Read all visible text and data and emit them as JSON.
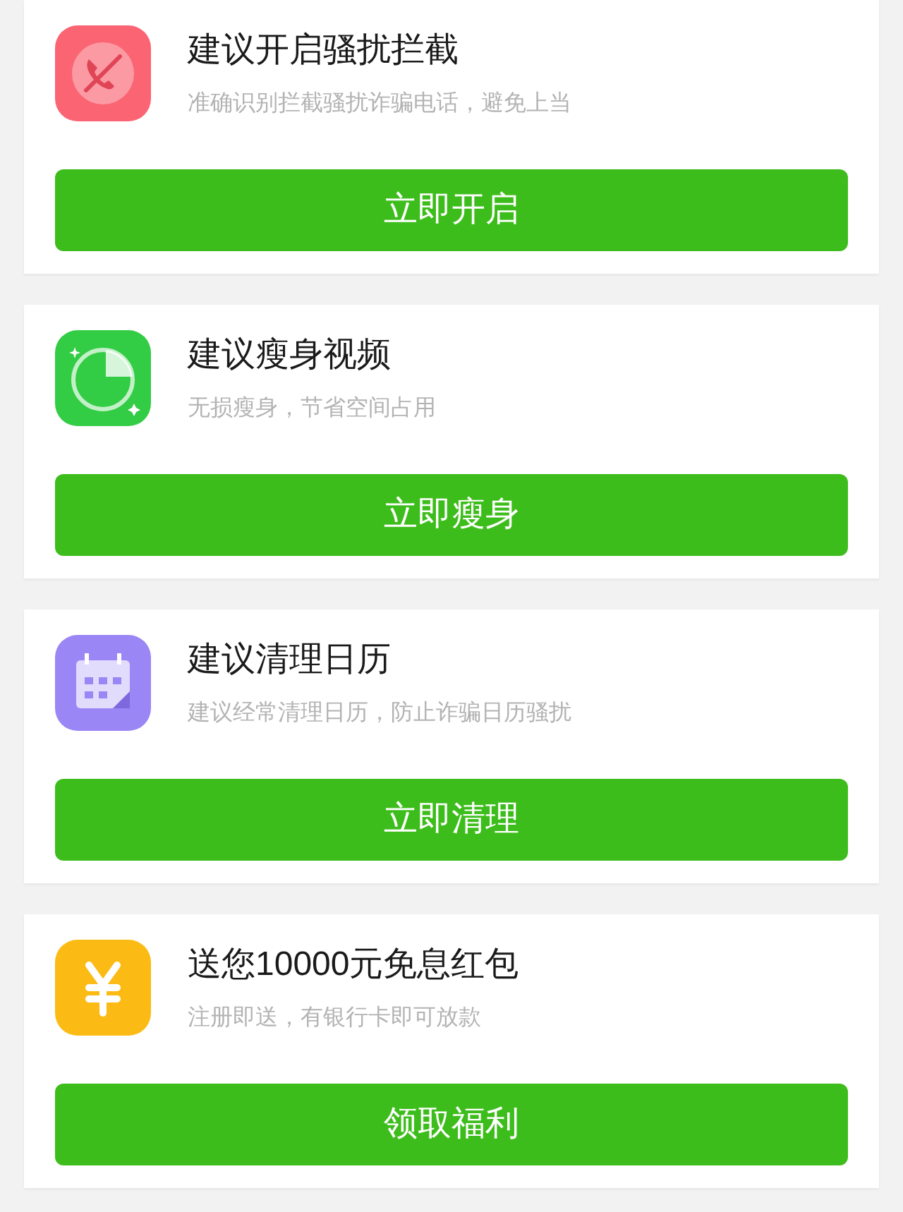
{
  "cards": [
    {
      "kind": "block-call",
      "color": "#fb6473",
      "title": "建议开启骚扰拦截",
      "subtitle": "准确识别拦截骚扰诈骗电话，避免上当",
      "button": "立即开启"
    },
    {
      "kind": "slim",
      "color": "#33cc45",
      "title": "建议瘦身视频",
      "subtitle": "无损瘦身，节省空间占用",
      "button": "立即瘦身"
    },
    {
      "kind": "calendar",
      "color": "#9b86f5",
      "title": "建议清理日历",
      "subtitle": "建议经常清理日历，防止诈骗日历骚扰",
      "button": "立即清理"
    },
    {
      "kind": "yuan",
      "color": "#fbbb14",
      "title": "送您10000元免息红包",
      "subtitle": "注册即送，有银行卡即可放款",
      "button": "领取福利"
    }
  ]
}
